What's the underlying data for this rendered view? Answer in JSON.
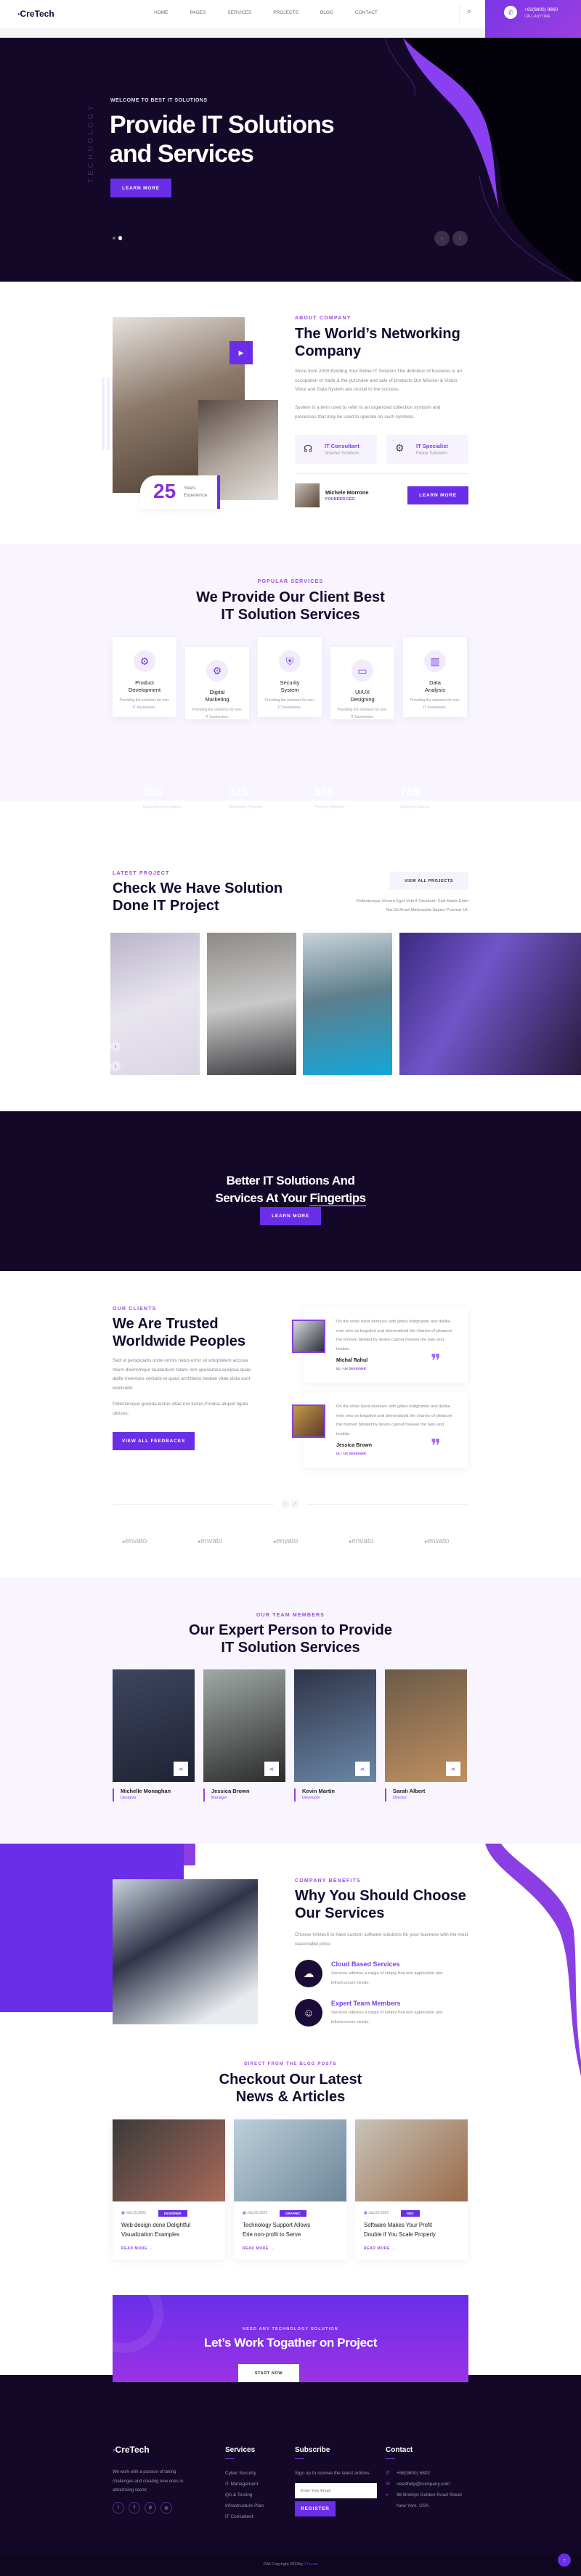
{
  "header": {
    "logo": "CreTech",
    "nav": [
      "HOME",
      "PAGES",
      "SERVICES",
      "PROJECTS",
      "BLOG",
      "CONTACT"
    ],
    "phone": "+92(8800) 9860",
    "phone_label": "CALL ANYTIME"
  },
  "hero": {
    "side_text": "TECHNOLOGY",
    "tagline": "WELCOME TO BEST IT SOLUTIONS",
    "title_line1": "Provide IT Solutions",
    "title_line2": "and Services",
    "button": "LEARN MORE",
    "prev": "‹",
    "next": "›",
    "slides": 2,
    "active_slide": 2
  },
  "about": {
    "tag": "ABOUT COMPANY",
    "title_line1": "The World’s Networking",
    "title_line2": "Company",
    "para1": "Since from 2000 Building Your Better IT Solution The definition of business is an occupation or trade & the purchase and sale of products Our Mission & Vision Voice and Data System are crucial to the success",
    "para2": "System is a term used to refer to an organized collection symbols and processes that may be used to operate on such symbols.",
    "features": [
      {
        "title": "IT Consultant",
        "sub": "Smarter Solutions",
        "icon": "headset-icon"
      },
      {
        "title": "IT Specialist",
        "sub": "Faster Solutions",
        "icon": "chip-icon"
      }
    ],
    "years": "25",
    "years_label1": "Years",
    "years_label2": "Experience",
    "founder_name": "Michele Morrone",
    "founder_role": "FOUNDER CEO",
    "button": "LEARN MORE"
  },
  "services": {
    "tag": "POPULAR SERVICES",
    "title_line1": "We Provide Our Client Best",
    "title_line2": "IT Solution Services",
    "items": [
      {
        "l1": "Product",
        "l2": "Development",
        "desc": "Providing the solutions for non-IT businesses.",
        "icon": "gear-icon"
      },
      {
        "l1": "Digital",
        "l2": "Marketing",
        "desc": "Providing the solutions for non-IT businesses.",
        "icon": "gear-icon"
      },
      {
        "l1": "Security",
        "l2": "System",
        "desc": "Providing the solutions for non-IT businesses.",
        "icon": "shield-icon"
      },
      {
        "l1": "UI/UX",
        "l2": "Designing",
        "desc": "Providing the solutions for non-IT businesses.",
        "icon": "monitor-icon"
      },
      {
        "l1": "Data",
        "l2": "Analysis",
        "desc": "Providing the solutions for non-IT businesses.",
        "icon": "chart-icon"
      }
    ]
  },
  "stats": [
    {
      "value": "255",
      "label": "Business Interogation"
    },
    {
      "value": "325",
      "label": "Strategies Planned"
    },
    {
      "value": "569",
      "label": "Projects Relased"
    },
    {
      "value": "769",
      "label": "Satisfied Clients"
    }
  ],
  "projects": {
    "tag": "LATEST PROJECT",
    "title_line1": "Check We Have Solution",
    "title_line2": "Done IT Project",
    "button": "VIEW ALL PROJECTS",
    "desc_line1": "Pellentesque Viverra Eget Velit A Tincidunt. Sed Mattis Enim",
    "desc_line2": "Nisl,Sit Amet Malesuada Sapien Pulvinar Ut.",
    "prev": "‹",
    "next": "›"
  },
  "cta": {
    "title_line1": "Better IT Solutions And",
    "title_line2a": "Services At Your ",
    "title_line2b": "Fingertips",
    "button": "LEARN MORE"
  },
  "clients": {
    "tag": "OUR CLIENTS",
    "title_line1": "We Are Trusted",
    "title_line2": "Worldwide Peoples",
    "para1": "Sed ut perspiciatis unde omnis natus error sit voluptatem accusa ntium doloremque laudantium totam rem aperiamea queipsa quae abillo inventore veritatis et quasi architecto beatae vitae dicta sunt explicabo.",
    "para2": "Pellentesque gravida lectus vitae nisi luctus,Finibus aliquet ligula ultrices.",
    "button": "VIEW ALL FEEDBACKS",
    "testimonials": [
      {
        "text": "On the other hand denounc with ghteo indignation and dislike men who so beguiled and demoralized the charms of pleasure the momen blinded by desire cannot foresee the pain and trouble.",
        "name": "Michal Rahul",
        "role": "UL - UX DESIGNER"
      },
      {
        "text": "On the other hand denounc with ghteo indignation and dislike men who so beguiled and demoralized the charms of pleasure the momen blinded by desire cannot foresee the pain and trouble.",
        "name": "Jessica Brown",
        "role": "UL - UX DESIGNER"
      }
    ],
    "prev": "‹",
    "next": "›",
    "brands": [
      "envato",
      "envato",
      "envato",
      "envato",
      "envato"
    ]
  },
  "team": {
    "tag": "OUR TEAM MEMBERS",
    "title_line1": "Our Expert Person to Provide",
    "title_line2": "IT Solution Services",
    "members": [
      {
        "name": "Michelle Monaghan",
        "role": "Designer"
      },
      {
        "name": "Jessica Brown",
        "role": "Manager"
      },
      {
        "name": "Kevin Martin",
        "role": "Developer"
      },
      {
        "name": "Sarah Albert",
        "role": "Director"
      }
    ]
  },
  "why": {
    "tag": "COMPANY BENEFITS",
    "title_line1": "Why You Should Choose",
    "title_line2": "Our Services",
    "desc": "Choose Infetech to have custom software solutions for your business with the most reasonable price.",
    "items": [
      {
        "title": "Cloud Based Services",
        "desc": "Services address a range of simply free text application and infrastructure needs.",
        "icon": "cloud-icon"
      },
      {
        "title": "Expert Team Members",
        "desc": "Services address a range of simply free text application and infrastructure needs.",
        "icon": "team-icon"
      }
    ]
  },
  "blog": {
    "tag": "DIRECT FROM THE BLOG POSTS",
    "title_line1": "Checkout Our Latest",
    "title_line2": "News & Articles",
    "read_more": "READ MORE →",
    "posts": [
      {
        "date": "July,25,2022",
        "cat": "DESIGNER",
        "t1": "Web design done Delightful",
        "t2": "Visualization Examples"
      },
      {
        "date": "July,25,2022",
        "cat": "GRAPHIC",
        "t1": "Technology Support Allows",
        "t2": "Erie non-profit to Serve"
      },
      {
        "date": "July,25,2022",
        "cat": "SEO",
        "t1": "Software Makes Your Profit",
        "t2": "Double if You Scale Properly"
      }
    ]
  },
  "banner": {
    "tag": "NEED ANY TECHNOLOGY SOLUTION",
    "title": "Let’s Work Togather on Project",
    "button": "START NOW"
  },
  "footer": {
    "logo": "CreTech",
    "about": "We work with a passion of taking challenges and creating new ones in advertising sector.",
    "socials": [
      "twitter-icon",
      "facebook-icon",
      "pinterest-icon",
      "instagram-icon"
    ],
    "services_title": "Services",
    "services": [
      "Cyber Security",
      "IT Management",
      "QA & Testing",
      "Infrastructure Plan",
      "IT Consultent"
    ],
    "subscribe_title": "Subscribe",
    "subscribe_text": "Sign up to receive the latest articles",
    "email_placeholder": "Enter Your Email",
    "register": "REGISTER",
    "contact_title": "Contact",
    "phone": "+88(9800) 6802",
    "email": "needhelp@company.com",
    "addr1": "88 Broklyn Golden Road Street",
    "addr2": "New York. USA",
    "copyright": "©All Copyright 2022by ",
    "copyright_link": "17sucai"
  },
  "colors": {
    "accent": "#6a2ee8",
    "dark": "#130828",
    "lavender": "#f8f5fe"
  }
}
